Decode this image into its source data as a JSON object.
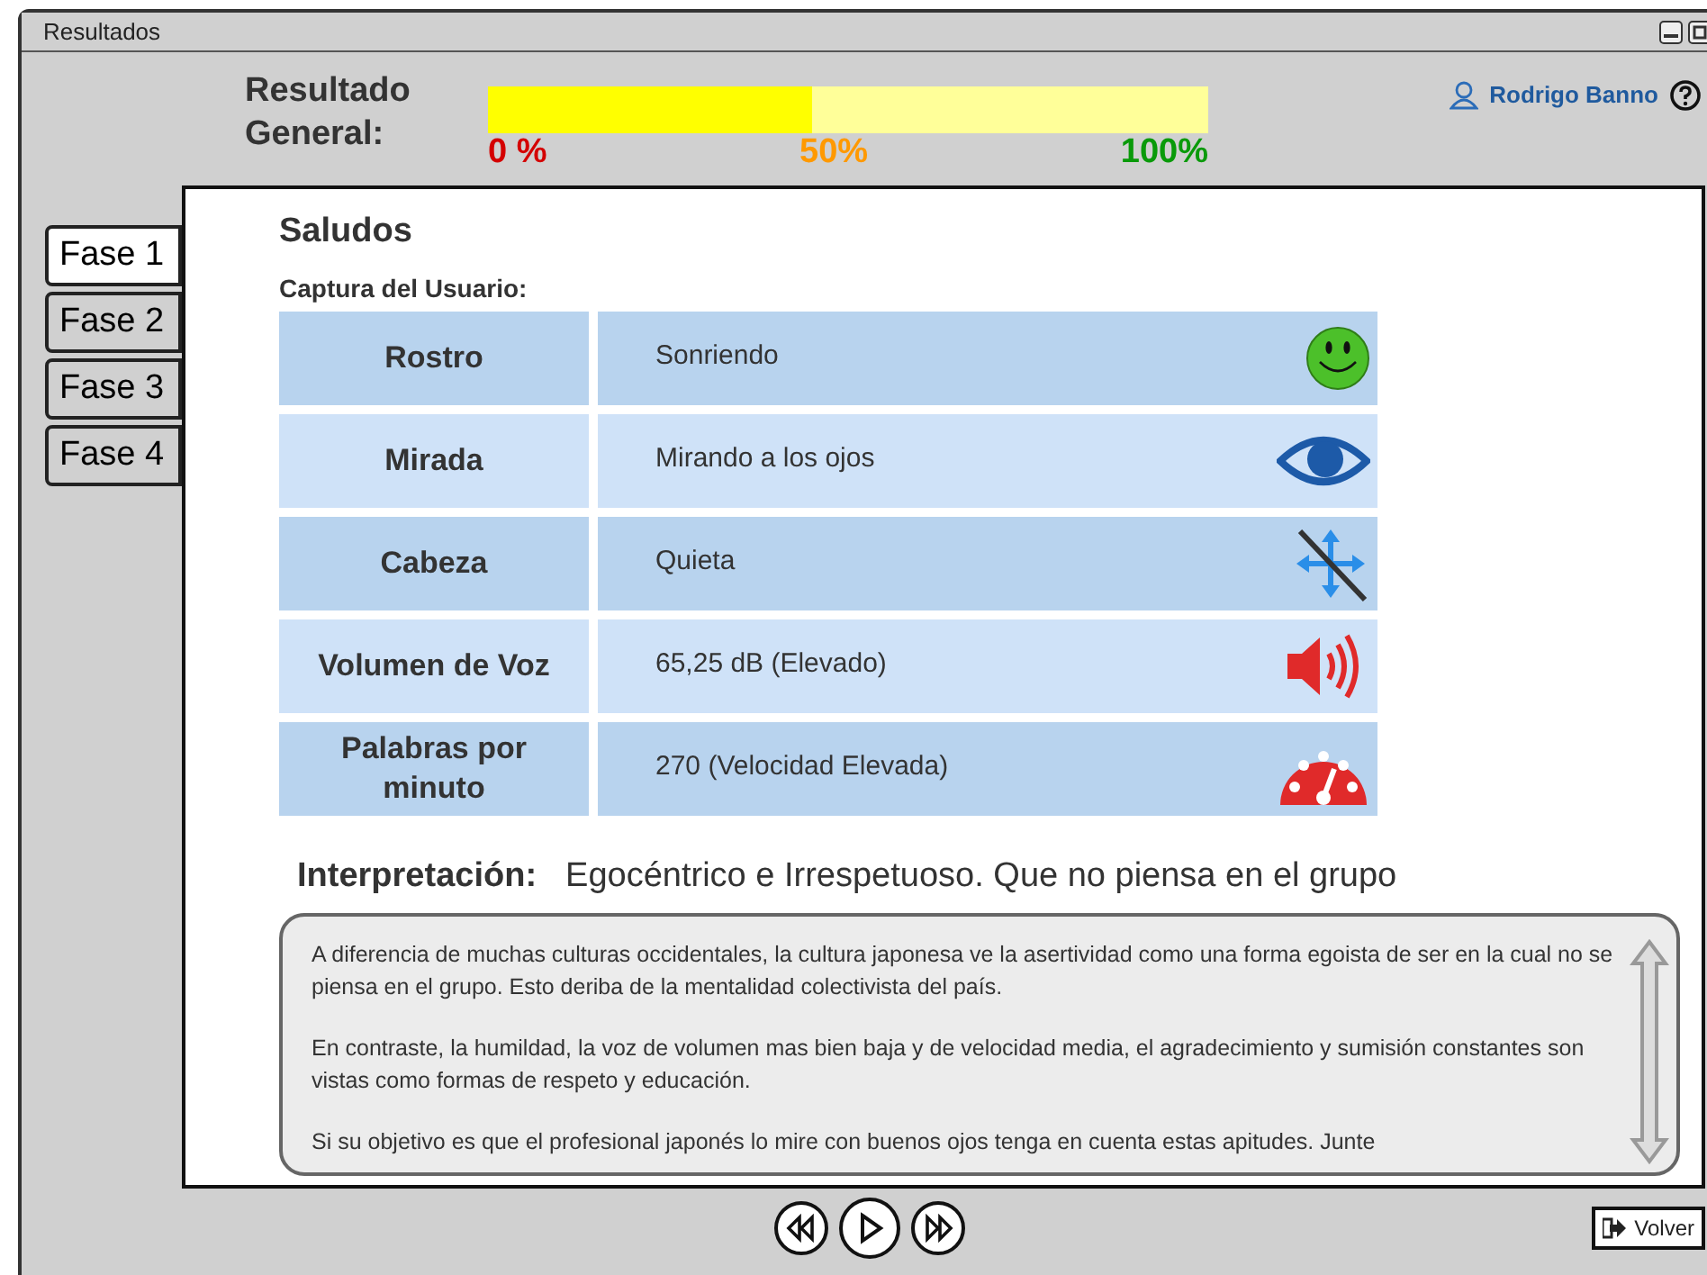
{
  "window": {
    "title": "Resultados"
  },
  "header": {
    "label": "Resultado General:",
    "progress": {
      "level": 0.45,
      "ticks": [
        "0 %",
        "50%",
        "100%"
      ]
    },
    "user": "Rodrigo Banno"
  },
  "tabs": [
    {
      "label": "Fase 1",
      "selected": true
    },
    {
      "label": "Fase 2",
      "selected": false
    },
    {
      "label": "Fase 3",
      "selected": false
    },
    {
      "label": "Fase 4",
      "selected": false
    }
  ],
  "section_title": "Saludos",
  "capture_label": "Captura del Usuario:",
  "rows": [
    {
      "label": "Rostro",
      "value": "Sonriendo",
      "kind": "smile"
    },
    {
      "label": "Mirada",
      "value": "Mirando a los ojos",
      "kind": "eye"
    },
    {
      "label": "Cabeza",
      "value": "Quieta",
      "kind": "still"
    },
    {
      "label": "Volumen de Voz",
      "value": "65,25 dB (Elevado)",
      "kind": "volume"
    },
    {
      "label": "Palabras por minuto",
      "value": "270 (Velocidad Elevada)",
      "kind": "speed"
    }
  ],
  "interpretation": {
    "label": "Interpretación:",
    "value": "Egocéntrico e Irrespetuoso. Que no piensa en el grupo",
    "paragraphs": [
      "A diferencia de muchas culturas occidentales, la cultura japonesa ve la asertividad como una forma egoista de ser en la cual no se piensa en el grupo. Esto deriba de la mentalidad colectivista del país.",
      "En contraste, la humildad, la voz de volumen mas bien baja y de velocidad media, el agradecimiento y sumisión constantes son vistas como formas de respeto y educación.",
      "Si su objetivo es que el profesional japonés lo mire con buenos ojos tenga en cuenta estas apitudes. Junte"
    ]
  },
  "back_button": "Volver"
}
